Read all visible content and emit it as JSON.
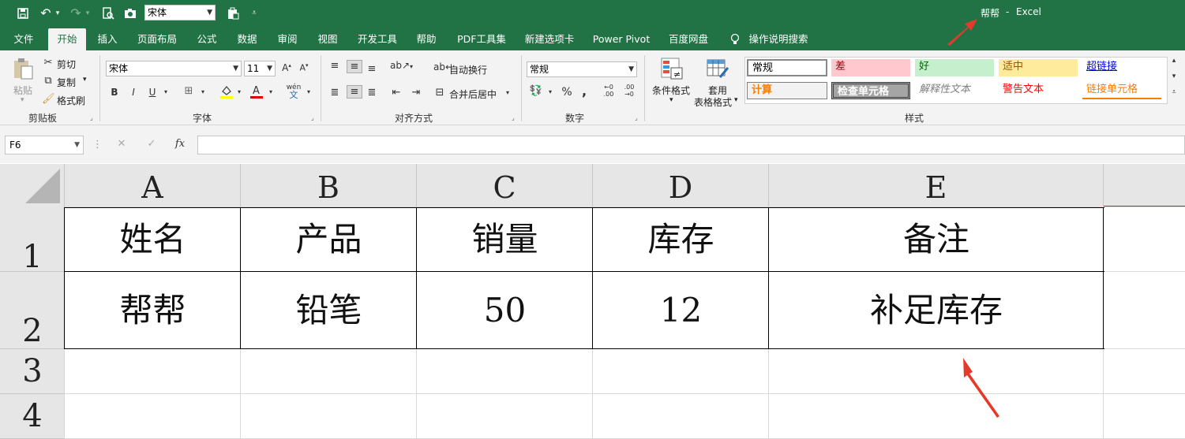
{
  "quick_access": {
    "font_value": "宋体",
    "title_doc": "帮帮",
    "title_sep": "-",
    "title_app": "Excel"
  },
  "tabs": [
    "文件",
    "开始",
    "插入",
    "页面布局",
    "公式",
    "数据",
    "审阅",
    "视图",
    "开发工具",
    "帮助",
    "PDF工具集",
    "新建选项卡",
    "Power Pivot",
    "百度网盘",
    "操作说明搜索"
  ],
  "clipboard": {
    "paste": "粘贴",
    "cut": "剪切",
    "copy": "复制",
    "format_painter": "格式刷",
    "group": "剪贴板"
  },
  "font": {
    "name": "宋体",
    "size": "11",
    "bold": "B",
    "italic": "I",
    "underline": "U",
    "group": "字体"
  },
  "alignment": {
    "wrap": "自动换行",
    "merge": "合并后居中",
    "group": "对齐方式"
  },
  "number": {
    "format": "常规",
    "percent": "%",
    "comma": ",",
    "group": "数字"
  },
  "styles_group": {
    "conditional": "条件格式",
    "table_format_1": "套用",
    "table_format_2": "表格格式",
    "group": "样式",
    "cells": [
      {
        "label": "常规",
        "color": "#000000",
        "bg": "#ffffff"
      },
      {
        "label": "差",
        "color": "#9c0006",
        "bg": "#ffc7ce"
      },
      {
        "label": "好",
        "color": "#006100",
        "bg": "#c6efce"
      },
      {
        "label": "适中",
        "color": "#9c5700",
        "bg": "#ffeb9c"
      },
      {
        "label": "超链接",
        "color": "#0000ee",
        "bg": "#ffffff"
      },
      {
        "label": "计算",
        "color": "#fa7d00",
        "bg": "#f2f2f2"
      },
      {
        "label": "检查单元格",
        "color": "#ffffff",
        "bg": "#a5a5a5"
      },
      {
        "label": "解释性文本",
        "color": "#7f7f7f",
        "bg": "#ffffff"
      },
      {
        "label": "警告文本",
        "color": "#ff0000",
        "bg": "#ffffff"
      },
      {
        "label": "链接单元格",
        "color": "#fa7d00",
        "bg": "#ffffff"
      }
    ]
  },
  "formula_bar": {
    "cell_ref": "F6",
    "fx": "fx",
    "value": ""
  },
  "grid": {
    "columns": [
      "A",
      "B",
      "C",
      "D",
      "E"
    ],
    "rows": [
      "1",
      "2",
      "3",
      "4"
    ],
    "data": [
      [
        "姓名",
        "产品",
        "销量",
        "库存",
        "备注"
      ],
      [
        "帮帮",
        "铅笔",
        "50",
        "12",
        "补足库存"
      ]
    ]
  },
  "colors": {
    "excel_green": "#217346",
    "arrow": "#e53a2a"
  }
}
